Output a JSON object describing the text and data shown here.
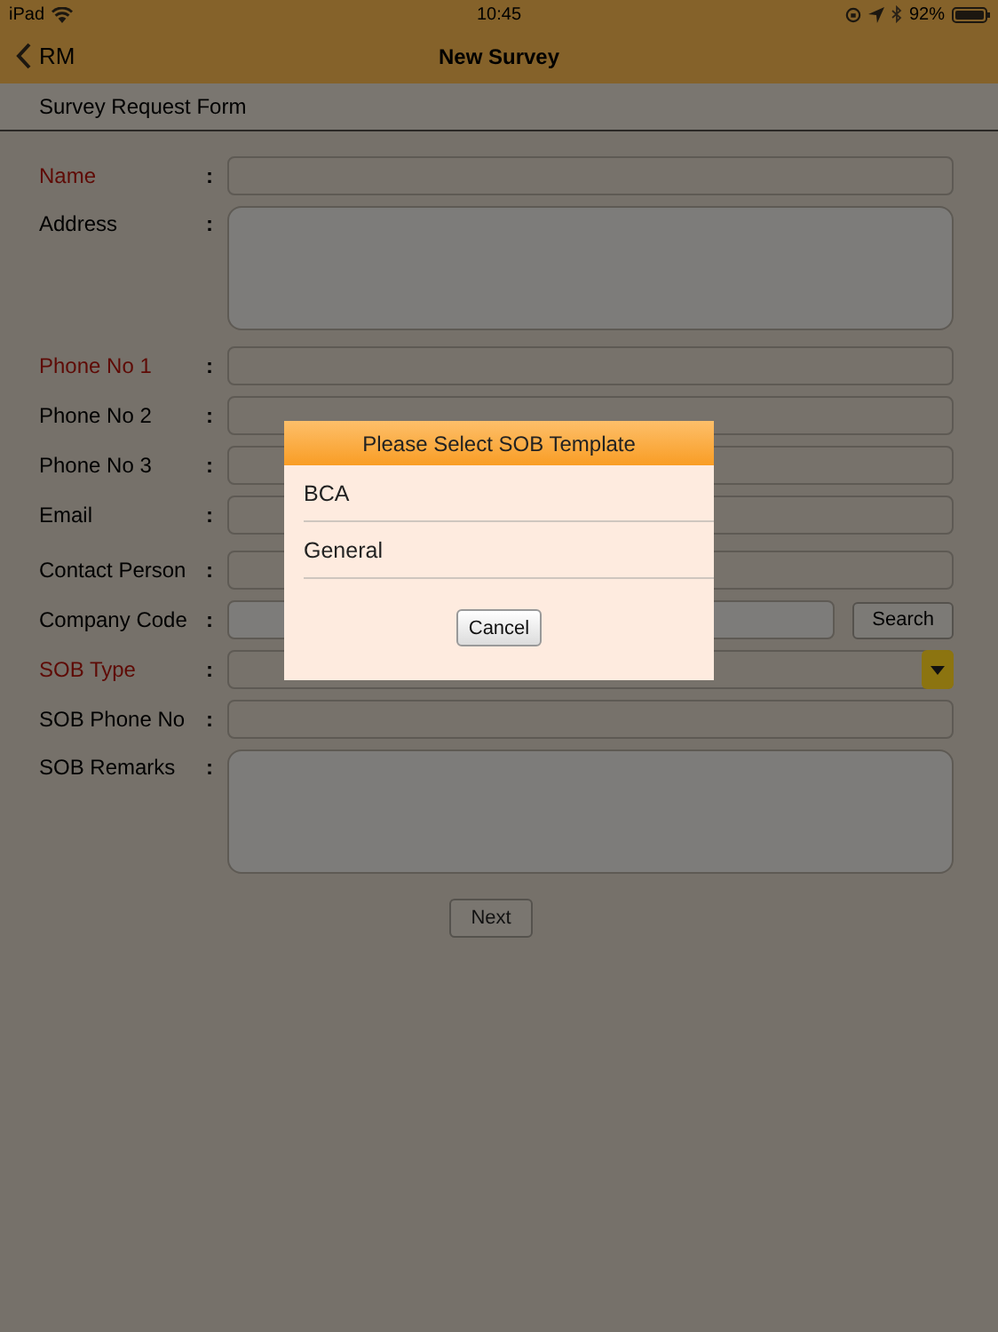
{
  "status_bar": {
    "device": "iPad",
    "time": "10:45",
    "battery": "92%"
  },
  "nav": {
    "back": "RM",
    "title": "New Survey"
  },
  "section_title": "Survey Request Form",
  "fields": [
    {
      "label": "Name",
      "kind": "text",
      "required": true
    },
    {
      "label": "Address",
      "kind": "textarea",
      "required": false
    },
    {
      "label": "Phone No 1",
      "kind": "text",
      "required": true
    },
    {
      "label": "Phone No 2",
      "kind": "text",
      "required": false
    },
    {
      "label": "Phone No 3",
      "kind": "text",
      "required": false
    },
    {
      "label": "Email",
      "kind": "text",
      "required": false
    },
    {
      "label": "Contact Person",
      "kind": "text",
      "required": false
    },
    {
      "label": "Company Code",
      "kind": "search",
      "required": false,
      "button": "Search"
    },
    {
      "label": "SOB Type",
      "kind": "select",
      "required": true
    },
    {
      "label": "SOB Phone No",
      "kind": "text",
      "required": false
    },
    {
      "label": "SOB Remarks",
      "kind": "textarea",
      "required": false
    }
  ],
  "colon": ":",
  "next_button": "Next",
  "dialog": {
    "title": "Please Select SOB Template",
    "options": [
      "BCA",
      "General"
    ],
    "cancel": "Cancel"
  }
}
